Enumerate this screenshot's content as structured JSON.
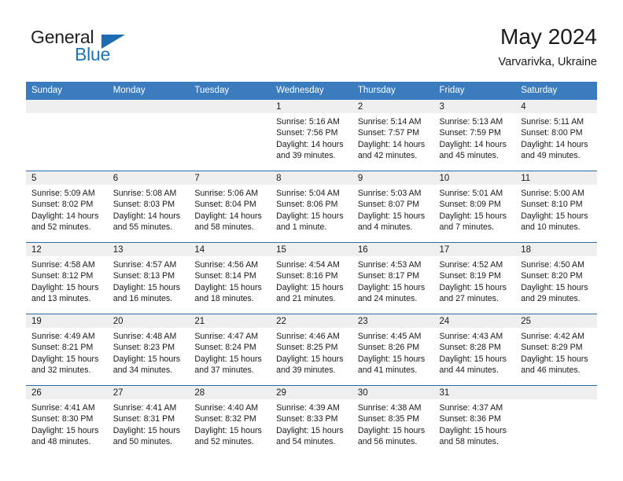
{
  "brand": {
    "line1": "General",
    "line2": "Blue",
    "logo_icon": "triangle-flag-icon",
    "accent_color": "#1b75bb"
  },
  "header": {
    "title": "May 2024",
    "subtitle": "Varvarivka, Ukraine"
  },
  "theme": {
    "header_bg": "#3a7cbe",
    "row_divider": "#2b6ca8",
    "daynum_band": "#efefef"
  },
  "labels": {
    "sunrise_prefix": "Sunrise:",
    "sunset_prefix": "Sunset:",
    "daylight_prefix": "Daylight:"
  },
  "weekdays": [
    "Sunday",
    "Monday",
    "Tuesday",
    "Wednesday",
    "Thursday",
    "Friday",
    "Saturday"
  ],
  "weeks": [
    [
      {
        "day": "",
        "empty": true
      },
      {
        "day": "",
        "empty": true
      },
      {
        "day": "",
        "empty": true
      },
      {
        "day": "1",
        "sunrise": "Sunrise: 5:16 AM",
        "sunset": "Sunset: 7:56 PM",
        "daylight1": "Daylight: 14 hours",
        "daylight2": "and 39 minutes."
      },
      {
        "day": "2",
        "sunrise": "Sunrise: 5:14 AM",
        "sunset": "Sunset: 7:57 PM",
        "daylight1": "Daylight: 14 hours",
        "daylight2": "and 42 minutes."
      },
      {
        "day": "3",
        "sunrise": "Sunrise: 5:13 AM",
        "sunset": "Sunset: 7:59 PM",
        "daylight1": "Daylight: 14 hours",
        "daylight2": "and 45 minutes."
      },
      {
        "day": "4",
        "sunrise": "Sunrise: 5:11 AM",
        "sunset": "Sunset: 8:00 PM",
        "daylight1": "Daylight: 14 hours",
        "daylight2": "and 49 minutes."
      }
    ],
    [
      {
        "day": "5",
        "sunrise": "Sunrise: 5:09 AM",
        "sunset": "Sunset: 8:02 PM",
        "daylight1": "Daylight: 14 hours",
        "daylight2": "and 52 minutes."
      },
      {
        "day": "6",
        "sunrise": "Sunrise: 5:08 AM",
        "sunset": "Sunset: 8:03 PM",
        "daylight1": "Daylight: 14 hours",
        "daylight2": "and 55 minutes."
      },
      {
        "day": "7",
        "sunrise": "Sunrise: 5:06 AM",
        "sunset": "Sunset: 8:04 PM",
        "daylight1": "Daylight: 14 hours",
        "daylight2": "and 58 minutes."
      },
      {
        "day": "8",
        "sunrise": "Sunrise: 5:04 AM",
        "sunset": "Sunset: 8:06 PM",
        "daylight1": "Daylight: 15 hours",
        "daylight2": "and 1 minute."
      },
      {
        "day": "9",
        "sunrise": "Sunrise: 5:03 AM",
        "sunset": "Sunset: 8:07 PM",
        "daylight1": "Daylight: 15 hours",
        "daylight2": "and 4 minutes."
      },
      {
        "day": "10",
        "sunrise": "Sunrise: 5:01 AM",
        "sunset": "Sunset: 8:09 PM",
        "daylight1": "Daylight: 15 hours",
        "daylight2": "and 7 minutes."
      },
      {
        "day": "11",
        "sunrise": "Sunrise: 5:00 AM",
        "sunset": "Sunset: 8:10 PM",
        "daylight1": "Daylight: 15 hours",
        "daylight2": "and 10 minutes."
      }
    ],
    [
      {
        "day": "12",
        "sunrise": "Sunrise: 4:58 AM",
        "sunset": "Sunset: 8:12 PM",
        "daylight1": "Daylight: 15 hours",
        "daylight2": "and 13 minutes."
      },
      {
        "day": "13",
        "sunrise": "Sunrise: 4:57 AM",
        "sunset": "Sunset: 8:13 PM",
        "daylight1": "Daylight: 15 hours",
        "daylight2": "and 16 minutes."
      },
      {
        "day": "14",
        "sunrise": "Sunrise: 4:56 AM",
        "sunset": "Sunset: 8:14 PM",
        "daylight1": "Daylight: 15 hours",
        "daylight2": "and 18 minutes."
      },
      {
        "day": "15",
        "sunrise": "Sunrise: 4:54 AM",
        "sunset": "Sunset: 8:16 PM",
        "daylight1": "Daylight: 15 hours",
        "daylight2": "and 21 minutes."
      },
      {
        "day": "16",
        "sunrise": "Sunrise: 4:53 AM",
        "sunset": "Sunset: 8:17 PM",
        "daylight1": "Daylight: 15 hours",
        "daylight2": "and 24 minutes."
      },
      {
        "day": "17",
        "sunrise": "Sunrise: 4:52 AM",
        "sunset": "Sunset: 8:19 PM",
        "daylight1": "Daylight: 15 hours",
        "daylight2": "and 27 minutes."
      },
      {
        "day": "18",
        "sunrise": "Sunrise: 4:50 AM",
        "sunset": "Sunset: 8:20 PM",
        "daylight1": "Daylight: 15 hours",
        "daylight2": "and 29 minutes."
      }
    ],
    [
      {
        "day": "19",
        "sunrise": "Sunrise: 4:49 AM",
        "sunset": "Sunset: 8:21 PM",
        "daylight1": "Daylight: 15 hours",
        "daylight2": "and 32 minutes."
      },
      {
        "day": "20",
        "sunrise": "Sunrise: 4:48 AM",
        "sunset": "Sunset: 8:23 PM",
        "daylight1": "Daylight: 15 hours",
        "daylight2": "and 34 minutes."
      },
      {
        "day": "21",
        "sunrise": "Sunrise: 4:47 AM",
        "sunset": "Sunset: 8:24 PM",
        "daylight1": "Daylight: 15 hours",
        "daylight2": "and 37 minutes."
      },
      {
        "day": "22",
        "sunrise": "Sunrise: 4:46 AM",
        "sunset": "Sunset: 8:25 PM",
        "daylight1": "Daylight: 15 hours",
        "daylight2": "and 39 minutes."
      },
      {
        "day": "23",
        "sunrise": "Sunrise: 4:45 AM",
        "sunset": "Sunset: 8:26 PM",
        "daylight1": "Daylight: 15 hours",
        "daylight2": "and 41 minutes."
      },
      {
        "day": "24",
        "sunrise": "Sunrise: 4:43 AM",
        "sunset": "Sunset: 8:28 PM",
        "daylight1": "Daylight: 15 hours",
        "daylight2": "and 44 minutes."
      },
      {
        "day": "25",
        "sunrise": "Sunrise: 4:42 AM",
        "sunset": "Sunset: 8:29 PM",
        "daylight1": "Daylight: 15 hours",
        "daylight2": "and 46 minutes."
      }
    ],
    [
      {
        "day": "26",
        "sunrise": "Sunrise: 4:41 AM",
        "sunset": "Sunset: 8:30 PM",
        "daylight1": "Daylight: 15 hours",
        "daylight2": "and 48 minutes."
      },
      {
        "day": "27",
        "sunrise": "Sunrise: 4:41 AM",
        "sunset": "Sunset: 8:31 PM",
        "daylight1": "Daylight: 15 hours",
        "daylight2": "and 50 minutes."
      },
      {
        "day": "28",
        "sunrise": "Sunrise: 4:40 AM",
        "sunset": "Sunset: 8:32 PM",
        "daylight1": "Daylight: 15 hours",
        "daylight2": "and 52 minutes."
      },
      {
        "day": "29",
        "sunrise": "Sunrise: 4:39 AM",
        "sunset": "Sunset: 8:33 PM",
        "daylight1": "Daylight: 15 hours",
        "daylight2": "and 54 minutes."
      },
      {
        "day": "30",
        "sunrise": "Sunrise: 4:38 AM",
        "sunset": "Sunset: 8:35 PM",
        "daylight1": "Daylight: 15 hours",
        "daylight2": "and 56 minutes."
      },
      {
        "day": "31",
        "sunrise": "Sunrise: 4:37 AM",
        "sunset": "Sunset: 8:36 PM",
        "daylight1": "Daylight: 15 hours",
        "daylight2": "and 58 minutes."
      },
      {
        "day": "",
        "empty": true
      }
    ]
  ]
}
